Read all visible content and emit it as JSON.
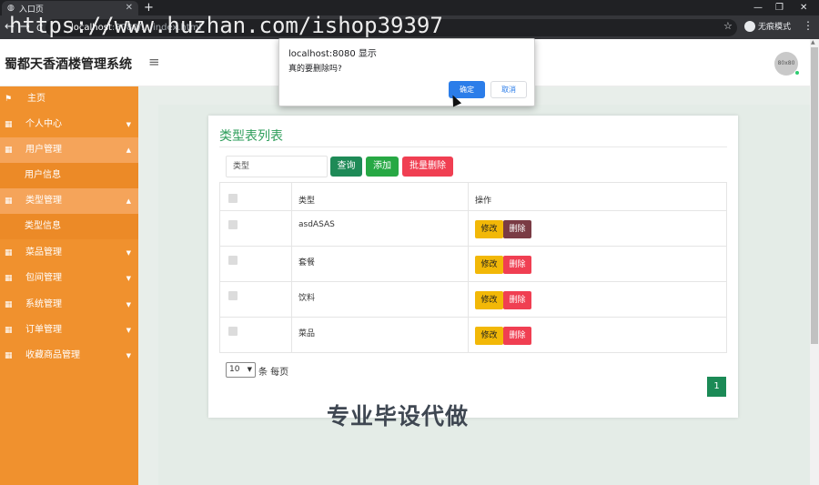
{
  "browser": {
    "tab_title": "入口页",
    "tab_close": "✕",
    "new_tab": "+",
    "url_host": "localhost",
    "url_path": ":8080/.../index.html",
    "incognito_label": "无痕模式",
    "win_min": "—",
    "win_max": "❐",
    "win_close": "✕",
    "back": "←",
    "forward": "→",
    "reload": "C",
    "star": "☆",
    "kebab": "⋮"
  },
  "watermark_url": "https://www.huzhan.com/ishop39397",
  "header": {
    "brand": "蜀都天香酒楼管理系统",
    "menu_icon": "≡",
    "avatar_text": "80x80"
  },
  "sidebar": {
    "home": "主页",
    "personal": "个人中心",
    "users": "用户管理",
    "user_info": "用户信息",
    "types": "类型管理",
    "type_info": "类型信息",
    "dishes": "菜品管理",
    "rooms": "包间管理",
    "system": "系统管理",
    "orders": "订单管理",
    "favorites": "收藏商品管理"
  },
  "main": {
    "title": "类型表列表",
    "search_placeholder": "类型",
    "btn_query": "查询",
    "btn_add": "添加",
    "btn_batch_delete": "批量删除",
    "col_type": "类型",
    "col_op": "操作",
    "edit_label": "修改",
    "delete_label": "删除",
    "rows": [
      "asdASAS",
      "套餐",
      "饮料",
      "菜品"
    ],
    "page_size": "10",
    "per_page_label": "条 每页",
    "current_page": "1"
  },
  "overlay_text": "专业毕设代做",
  "dialog": {
    "title": "localhost:8080 显示",
    "message": "真的要删除吗?",
    "ok": "确定",
    "cancel": "取消"
  }
}
